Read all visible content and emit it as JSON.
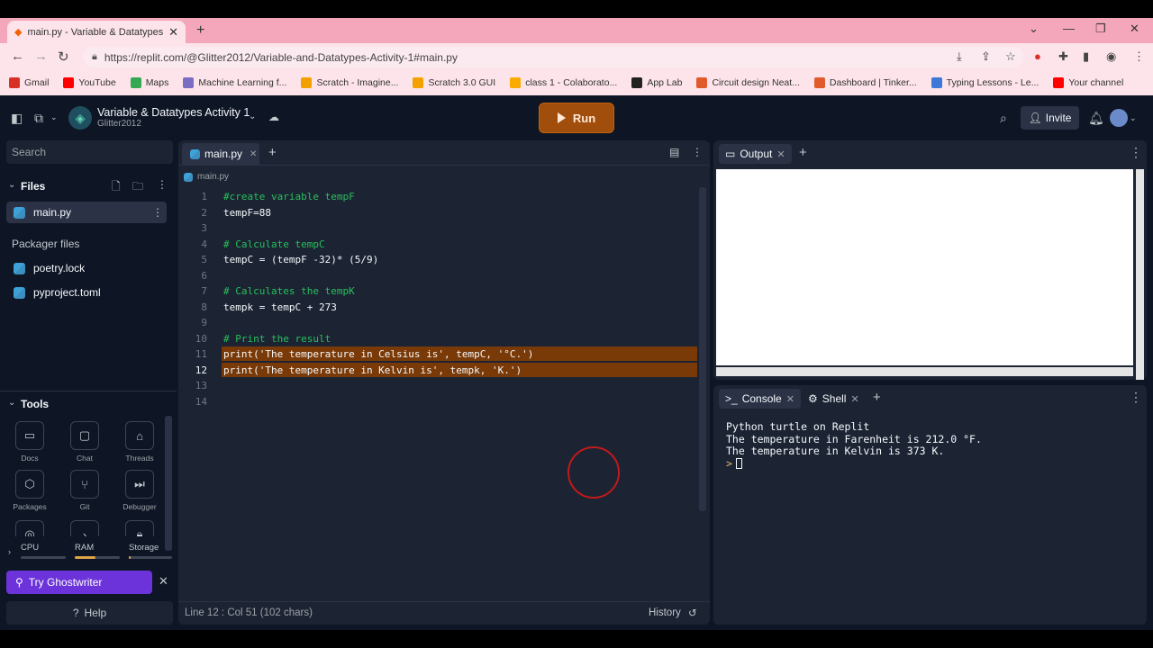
{
  "browser": {
    "tab_title": "main.py - Variable & Datatypes A",
    "url": "https://replit.com/@Glitter2012/Variable-and-Datatypes-Activity-1#main.py",
    "bookmarks": [
      {
        "label": "Gmail",
        "color": "#d93025",
        "icon": "gmail-icon"
      },
      {
        "label": "YouTube",
        "color": "#ff0000",
        "icon": "youtube-icon"
      },
      {
        "label": "Maps",
        "color": "#34a853",
        "icon": "maps-icon"
      },
      {
        "label": "Machine Learning f...",
        "color": "#7c6dc4",
        "icon": "bookmark-icon"
      },
      {
        "label": "Scratch - Imagine...",
        "color": "#f2a100",
        "icon": "scratch-icon"
      },
      {
        "label": "Scratch 3.0 GUI",
        "color": "#f2a100",
        "icon": "scratch-icon"
      },
      {
        "label": "class 1 - Colaborato...",
        "color": "#f9ab00",
        "icon": "colab-icon"
      },
      {
        "label": "App Lab",
        "color": "#222222",
        "icon": "applab-icon"
      },
      {
        "label": "Circuit design Neat...",
        "color": "#e05a2b",
        "icon": "tinkercad-icon"
      },
      {
        "label": "Dashboard | Tinker...",
        "color": "#e05a2b",
        "icon": "tinkercad-icon"
      },
      {
        "label": "Typing Lessons - Le...",
        "color": "#3b78d8",
        "icon": "typing-icon"
      },
      {
        "label": "Your channel",
        "color": "#ff0000",
        "icon": "youtube-icon"
      }
    ]
  },
  "topbar": {
    "repl_name": "Variable & Datatypes Activity 1",
    "owner": "Glitter2012",
    "run_label": "Run",
    "invite_label": "Invite"
  },
  "sidebar": {
    "search_placeholder": "Search",
    "files_heading": "Files",
    "files": [
      {
        "label": "main.py"
      }
    ],
    "packager_heading": "Packager files",
    "packager_files": [
      {
        "label": "poetry.lock"
      },
      {
        "label": "pyproject.toml"
      }
    ],
    "tools_heading": "Tools",
    "tools": [
      {
        "label": "Docs",
        "icon": "docs-icon"
      },
      {
        "label": "Chat",
        "icon": "chat-icon"
      },
      {
        "label": "Threads",
        "icon": "threads-icon"
      },
      {
        "label": "Packages",
        "icon": "packages-icon"
      },
      {
        "label": "Git",
        "icon": "git-icon"
      },
      {
        "label": "Debugger",
        "icon": "debugger-icon"
      }
    ],
    "resources": [
      {
        "label": "CPU",
        "fill": 0.0
      },
      {
        "label": "RAM",
        "fill": 0.45
      },
      {
        "label": "Storage",
        "fill": 0.05
      }
    ],
    "ghostwriter_label": "Try Ghostwriter",
    "help_label": "Help"
  },
  "editor": {
    "tab_label": "main.py",
    "breadcrumb": "main.py",
    "current_line": 12,
    "highlight_lines": [
      11,
      12
    ],
    "lines": [
      {
        "n": "1",
        "text": "#create variable tempF",
        "kind": "comment"
      },
      {
        "n": "2",
        "text": "tempF=88",
        "kind": "code"
      },
      {
        "n": "3",
        "text": "",
        "kind": "code"
      },
      {
        "n": "4",
        "text": "# Calculate tempC",
        "kind": "comment"
      },
      {
        "n": "5",
        "text": "tempC = (tempF -32)* (5/9)",
        "kind": "code"
      },
      {
        "n": "6",
        "text": "",
        "kind": "code"
      },
      {
        "n": "7",
        "text": "# Calculates the tempK",
        "kind": "comment"
      },
      {
        "n": "8",
        "text": "tempk = tempC + 273",
        "kind": "code"
      },
      {
        "n": "9",
        "text": "",
        "kind": "code"
      },
      {
        "n": "10",
        "text": "# Print the result",
        "kind": "comment"
      },
      {
        "n": "11",
        "text": "print('The temperature in Celsius is', tempC, '°C.')",
        "kind": "code"
      },
      {
        "n": "12",
        "text": "print('The temperature in Kelvin is', tempk, 'K.')",
        "kind": "code"
      },
      {
        "n": "13",
        "text": "",
        "kind": "code"
      },
      {
        "n": "14",
        "text": "",
        "kind": "code"
      }
    ],
    "status_position": "Line 12 : Col 51 (102 chars)",
    "history_label": "History"
  },
  "output_pane": {
    "tab_label": "Output"
  },
  "console_pane": {
    "tabs": [
      {
        "label": "Console"
      },
      {
        "label": "Shell"
      }
    ],
    "lines": [
      "Python turtle on Replit",
      "The temperature in Farenheit is 212.0 °F.",
      "The temperature in Kelvin is 373 K."
    ],
    "prompt": ">"
  }
}
